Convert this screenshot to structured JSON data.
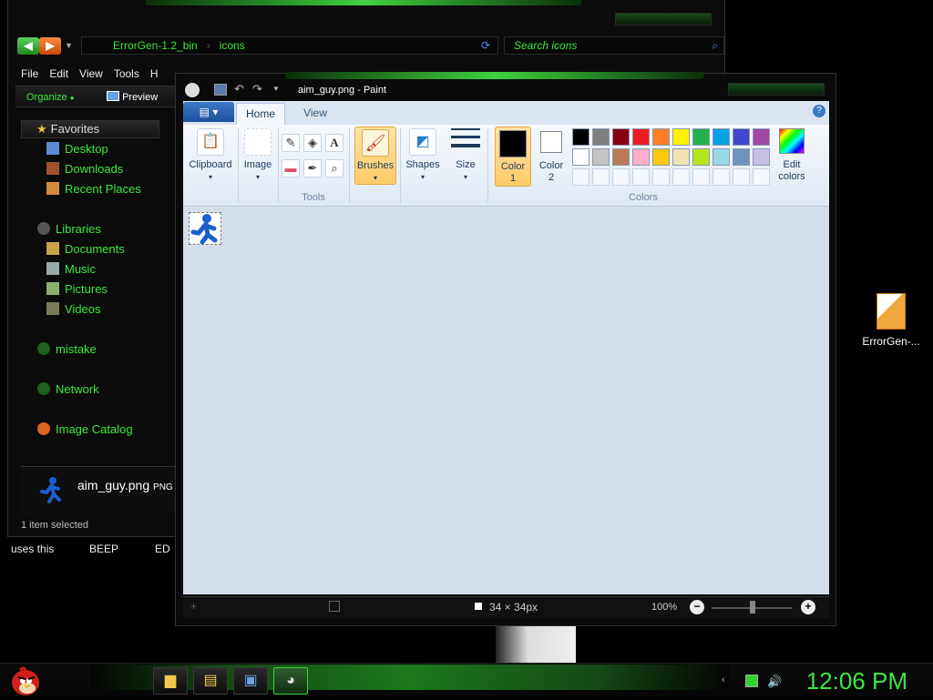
{
  "explorer": {
    "address": {
      "folder": "ErrorGen-1.2_bin",
      "subfolder": "icons"
    },
    "search_placeholder": "Search icons",
    "menu": [
      "File",
      "Edit",
      "View",
      "Tools",
      "H"
    ],
    "commands": {
      "organize": "Organize",
      "preview": "Preview"
    },
    "nav": {
      "favorites": "Favorites",
      "favorites_items": [
        "Desktop",
        "Downloads",
        "Recent Places"
      ],
      "libraries": "Libraries",
      "libraries_items": [
        "Documents",
        "Music",
        "Pictures",
        "Videos"
      ],
      "mistake": "mistake",
      "network": "Network",
      "image_catalog": "Image Catalog"
    },
    "details": {
      "filename": "aim_guy.png",
      "type": "PNG in"
    },
    "status": "1 item selected",
    "below_text": [
      "uses this",
      "BEEP",
      "ED"
    ]
  },
  "paint": {
    "title": "aim_guy.png - Paint",
    "tabs": {
      "home": "Home",
      "view": "View"
    },
    "groups": {
      "clipboard": "Clipboard",
      "image": "Image",
      "tools": "Tools",
      "brushes": "Brushes",
      "shapes": "Shapes",
      "size": "Size",
      "color1": "Color\n1",
      "color2": "Color\n2",
      "colors": "Colors",
      "edit_colors": "Edit colors"
    },
    "palette": [
      "#000000",
      "#7f7f7f",
      "#880015",
      "#ed1c24",
      "#ff7f27",
      "#fff200",
      "#22b14c",
      "#00a2e8",
      "#3f48cc",
      "#a349a4",
      "#ffffff",
      "#c3c3c3",
      "#b97a57",
      "#ffaec9",
      "#ffc90e",
      "#efe4b0",
      "#b5e61d",
      "#99d9ea",
      "#7092be",
      "#c8bfe7"
    ],
    "color1_value": "#000000",
    "color2_value": "#ffffff",
    "status": {
      "dimensions": "34 × 34px",
      "zoom": "100%"
    }
  },
  "desktop": {
    "icon_label": "ErrorGen-..."
  },
  "taskbar": {
    "clock": "12:06 PM"
  }
}
